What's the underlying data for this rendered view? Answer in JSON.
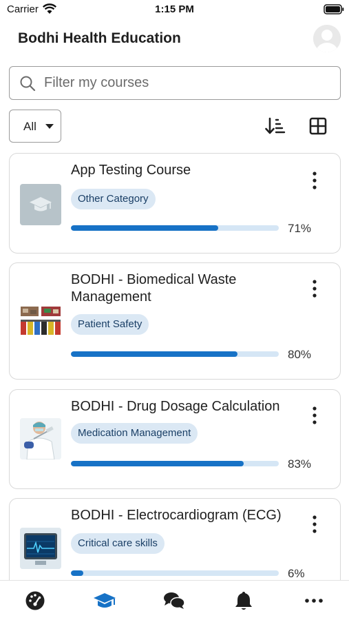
{
  "status_bar": {
    "carrier": "Carrier",
    "time": "1:15 PM"
  },
  "header": {
    "title": "Bodhi Health Education"
  },
  "search": {
    "placeholder": "Filter my courses",
    "value": ""
  },
  "filter": {
    "selected": "All"
  },
  "courses": [
    {
      "title": "App Testing Course",
      "category": "Other Category",
      "progress": 71,
      "progress_label": "71%",
      "thumbnail": "graduation-cap-placeholder"
    },
    {
      "title": "BODHI - Biomedical Waste Management",
      "category": "Patient Safety",
      "progress": 80,
      "progress_label": "80%",
      "thumbnail": "waste-bins-photo"
    },
    {
      "title": "BODHI - Drug Dosage Calculation",
      "category": "Medication Management",
      "progress": 83,
      "progress_label": "83%",
      "thumbnail": "doctor-syringe-photo"
    },
    {
      "title": "BODHI - Electrocardiogram (ECG)",
      "category": "Critical care skills",
      "progress": 6,
      "progress_label": "6%",
      "thumbnail": "ecg-monitor-photo"
    }
  ],
  "tabs": [
    {
      "icon": "dashboard-icon",
      "active": false
    },
    {
      "icon": "courses-icon",
      "active": true
    },
    {
      "icon": "messages-icon",
      "active": false
    },
    {
      "icon": "notifications-icon",
      "active": false
    },
    {
      "icon": "more-icon",
      "active": false
    }
  ],
  "colors": {
    "accent": "#1772c6",
    "badge_bg": "#dbe8f4",
    "progress_track": "#d5e6f5",
    "tab_inactive": "#1f1f1f"
  }
}
